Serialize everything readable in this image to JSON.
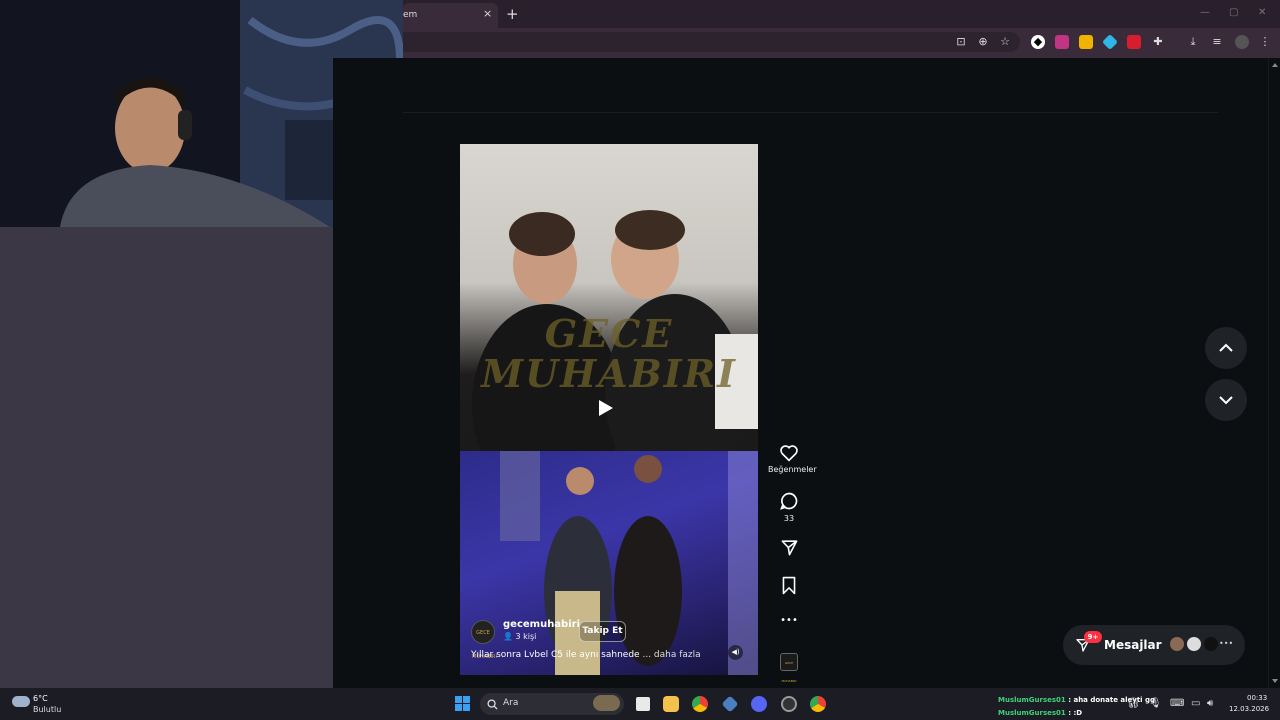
{
  "browser": {
    "tab_title": "em",
    "tab_close": "×",
    "new_tab": "+",
    "window_controls": [
      "—",
      "▢",
      "✕"
    ]
  },
  "post": {
    "watermark_lines": [
      "GECE",
      "MUHABIRI"
    ],
    "avatar_text": "GECE MUHABIRI",
    "username": "gecemuhabiri",
    "followers": "👤 3 kişi",
    "follow_label": "Takip Et",
    "caption": "Yıllar sonra Lvbel C5 ile aynı sahnede",
    "caption_more": "... daha fazla"
  },
  "actions": {
    "likes_label": "Beğenmeler",
    "comments_count": "33",
    "more": "•••"
  },
  "messages": {
    "badge": "9+",
    "label": "Mesajlar",
    "more": "•••"
  },
  "taskbar": {
    "temperature": "6°C",
    "weather_desc": "Bulutlu",
    "search_label": "Ara",
    "chat": [
      {
        "name": "MuslumGurses01",
        "text": " : aha donate aleyti gg"
      },
      {
        "name": "MuslumGurses01",
        "text": " : :D"
      }
    ],
    "time": "00:33",
    "date": "12.03.2026"
  },
  "colors": {
    "accent": "#ff3040",
    "chat_name": "#3fd07a",
    "browser_frame": "#3a2b3b"
  }
}
